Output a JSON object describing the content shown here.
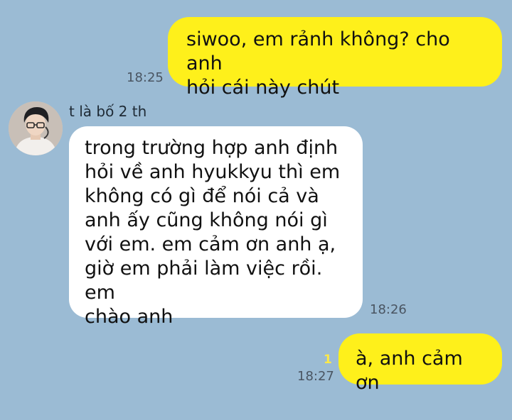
{
  "conversation": {
    "messages": [
      {
        "direction": "outgoing",
        "text": "siwoo, em rảnh không? cho anh\nhỏi cái này chút",
        "time": "18:25"
      },
      {
        "direction": "incoming",
        "sender": "t là bố 2 th",
        "text": "trong trường hợp anh định\nhỏi về anh hyukkyu thì em\nkhông có gì để nói cả và\nanh ấy cũng không nói gì\nvới em. em cảm ơn anh ạ,\ngiờ em phải làm việc rồi. em\nchào anh",
        "time": "18:26"
      },
      {
        "direction": "outgoing",
        "text": "à, anh cảm ơn",
        "time": "18:27",
        "unread_count": "1"
      }
    ]
  },
  "colors": {
    "background": "#9bbbd4",
    "outgoing_bubble": "#fef01b",
    "incoming_bubble": "#ffffff",
    "unread_badge": "#fbe84a"
  },
  "icons": {
    "avatar": "profile-photo"
  }
}
